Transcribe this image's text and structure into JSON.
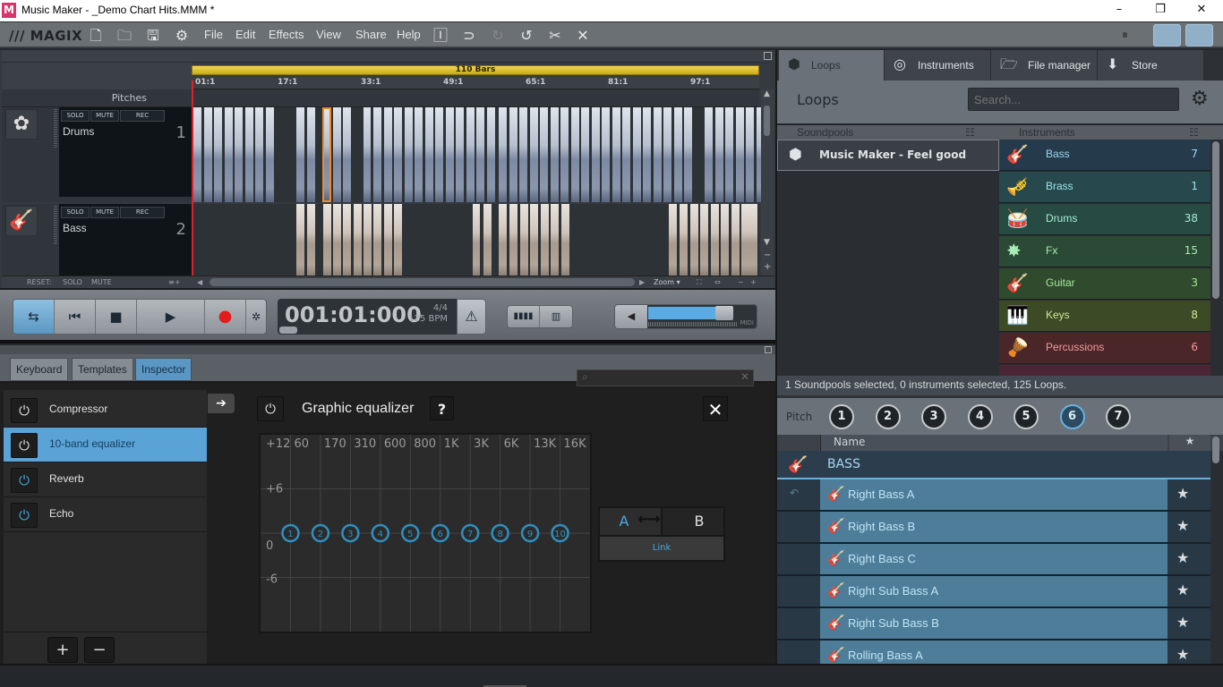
{
  "window": {
    "title": "Music Maker - _Demo Chart Hits.MMM *",
    "app_icon": "magix-m-logo",
    "controls": {
      "minimize": "–",
      "restore": "❐",
      "close": "✕"
    }
  },
  "menubar": {
    "brand": "/// MAGIX",
    "toolbar_icons": [
      "new-file-icon",
      "open-folder-icon",
      "save-icon",
      "settings-gears-icon"
    ],
    "menus": [
      "File",
      "Edit",
      "Effects",
      "View",
      "Share",
      "Help"
    ],
    "edit_icons": [
      "help-tips-icon",
      "undo-menu-icon",
      "redo-icon",
      "undo-icon",
      "cut-icon",
      "delete-icon"
    ]
  },
  "arranger": {
    "loop_range_label": "110 Bars",
    "ruler_ticks": [
      "01:1",
      "17:1",
      "33:1",
      "49:1",
      "65:1",
      "81:1",
      "97:1"
    ],
    "pitches_label": "Pitches",
    "tracks": [
      {
        "name": "Drums",
        "number": "1",
        "icon": "drums-icon",
        "solo": "SOLO",
        "mute": "MUTE",
        "rec": "REC"
      },
      {
        "name": "Bass",
        "number": "2",
        "icon": "bass-guitar-icon",
        "solo": "SOLO",
        "mute": "MUTE",
        "rec": "REC"
      }
    ],
    "reset_label": "RESET:",
    "reset_solo": "SOLO",
    "reset_mute": "MUTE",
    "zoom_label": "Zoom ▾"
  },
  "transport": {
    "time": "001:01:000",
    "signature": "4/4",
    "tempo": "125 BPM",
    "midi_label": "MIDI",
    "volume_level": 0.85
  },
  "lower": {
    "tabs": [
      "Keyboard",
      "Templates",
      "Inspector"
    ],
    "active_tab": "Inspector",
    "effects": [
      {
        "name": "Compressor",
        "active": false,
        "selected": false
      },
      {
        "name": "10-band equalizer",
        "active": false,
        "selected": true
      },
      {
        "name": "Reverb",
        "active": true,
        "selected": false
      },
      {
        "name": "Echo",
        "active": true,
        "selected": false
      }
    ],
    "add_label": "+",
    "remove_label": "−",
    "eq": {
      "title": "Graphic equalizer",
      "help": "?",
      "close": "✕",
      "db_labels": [
        "+12",
        "+6",
        "0",
        "-6"
      ],
      "freq_labels": [
        "60",
        "170",
        "310",
        "600",
        "800",
        "1K",
        "3K",
        "6K",
        "13K",
        "16K"
      ],
      "bands": [
        {
          "id": "1",
          "gain_db": 0
        },
        {
          "id": "2",
          "gain_db": 0
        },
        {
          "id": "3",
          "gain_db": 0
        },
        {
          "id": "4",
          "gain_db": 0
        },
        {
          "id": "5",
          "gain_db": 0
        },
        {
          "id": "6",
          "gain_db": 0
        },
        {
          "id": "7",
          "gain_db": 0
        },
        {
          "id": "8",
          "gain_db": 0
        },
        {
          "id": "9",
          "gain_db": 0
        },
        {
          "id": "10",
          "gain_db": 0
        }
      ],
      "a_label": "A",
      "b_label": "B",
      "link_label": "Link"
    }
  },
  "right": {
    "tabs": [
      {
        "label": "Loops",
        "icon": "loops-icon"
      },
      {
        "label": "Instruments",
        "icon": "instruments-icon"
      },
      {
        "label": "File manager",
        "icon": "folder-icon"
      },
      {
        "label": "Store",
        "icon": "download-icon"
      }
    ],
    "active_tab": "Loops",
    "title": "Loops",
    "search_placeholder": "Search...",
    "soundpools_header": "Soundpools",
    "instruments_header": "Instruments",
    "soundpools": [
      "Music Maker - Feel good"
    ],
    "instruments": [
      {
        "name": "Bass",
        "count": "7",
        "bg": "#253b4b",
        "fg": "#9fd7f3",
        "glyph": "🎸"
      },
      {
        "name": "Brass",
        "count": "1",
        "bg": "#27484d",
        "fg": "#9ee3ea",
        "glyph": "🎺"
      },
      {
        "name": "Drums",
        "count": "38",
        "bg": "#274a42",
        "fg": "#a5ecd2",
        "glyph": "🥁"
      },
      {
        "name": "Fx",
        "count": "15",
        "bg": "#2b4a35",
        "fg": "#a9ebb6",
        "glyph": "✸"
      },
      {
        "name": "Guitar",
        "count": "3",
        "bg": "#2f4a2c",
        "fg": "#a9e6a0",
        "glyph": "🎸"
      },
      {
        "name": "Keys",
        "count": "8",
        "bg": "#3c4a26",
        "fg": "#d3e89a",
        "glyph": "🎹"
      },
      {
        "name": "Percussions",
        "count": "6",
        "bg": "#4b2629",
        "fg": "#f19a9a",
        "glyph": "🪘"
      }
    ],
    "status": "1 Soundpools selected, 0 instruments selected, 125 Loops.",
    "pitch_label": "Pitch",
    "pitches": [
      "1",
      "2",
      "3",
      "4",
      "5",
      "6",
      "7"
    ],
    "selected_pitch": "6",
    "list_name_header": "Name",
    "group_label": "BASS",
    "loops": [
      "Right Bass A",
      "Right Bass B",
      "Right Bass C",
      "Right Sub Bass A",
      "Right Sub Bass B",
      "Rolling Bass A"
    ]
  }
}
